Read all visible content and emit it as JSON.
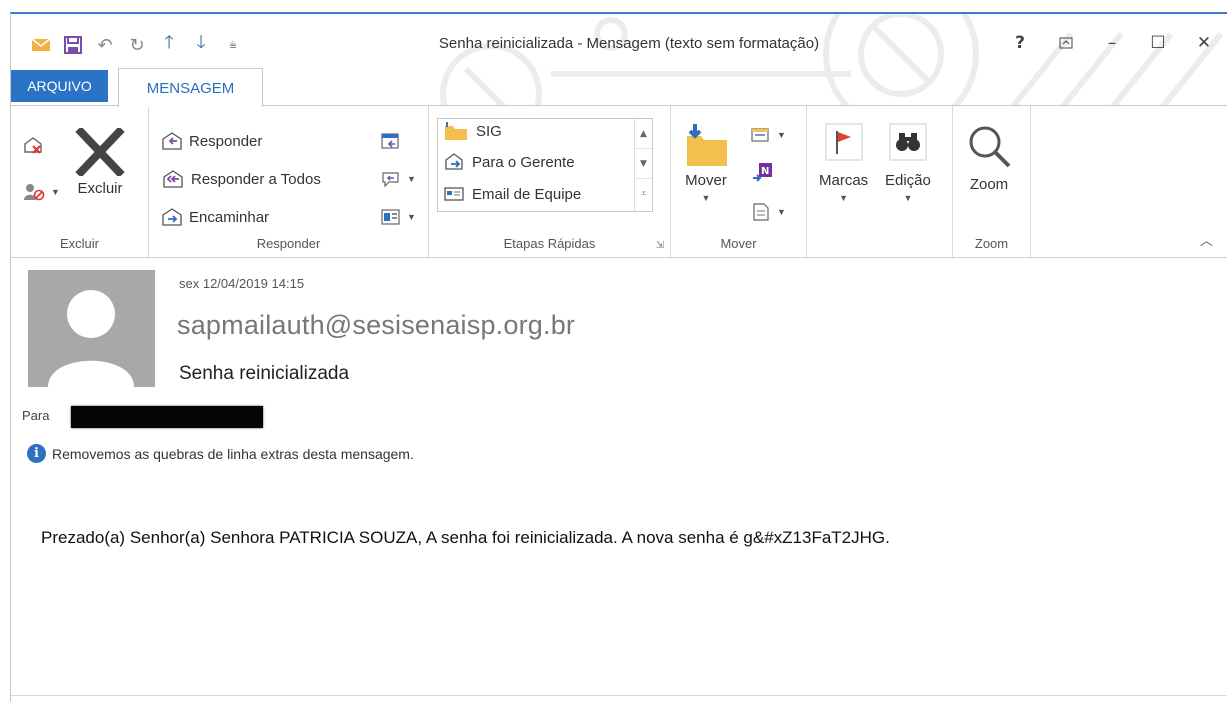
{
  "window": {
    "title": "Senha reinicializada - Mensagem (texto sem formatação)",
    "controls": {
      "help": "?",
      "ribbon_display": "⊼",
      "minimize": "–",
      "maximize": "☐",
      "close": "✕"
    }
  },
  "quick_access": [
    {
      "name": "mail-icon",
      "glyph": "✉"
    },
    {
      "name": "save-icon",
      "glyph": "🖫"
    },
    {
      "name": "undo-icon",
      "glyph": "↶"
    },
    {
      "name": "redo-icon",
      "glyph": "↻"
    },
    {
      "name": "up-arrow-icon",
      "glyph": "↑"
    },
    {
      "name": "down-arrow-icon",
      "glyph": "↓"
    },
    {
      "name": "customize-qat-icon",
      "glyph": "⩧"
    }
  ],
  "tabs": {
    "arquivo": "ARQUIVO",
    "mensagem": "MENSAGEM"
  },
  "ribbon": {
    "excluir": {
      "group_label": "Excluir",
      "delete_label": "Excluir"
    },
    "responder": {
      "group_label": "Responder",
      "reply": "Responder",
      "reply_all": "Responder a Todos",
      "forward": "Encaminhar"
    },
    "etapas": {
      "group_label": "Etapas Rápidas",
      "items": [
        "SIG",
        "Para o Gerente",
        "Email de Equipe"
      ]
    },
    "mover": {
      "group_label": "Mover",
      "move_label": "Mover"
    },
    "marcas": {
      "label": "Marcas"
    },
    "edicao": {
      "label": "Edição"
    },
    "zoom": {
      "group_label": "Zoom",
      "label": "Zoom"
    }
  },
  "message": {
    "date": "sex 12/04/2019 14:15",
    "sender": "sapmailauth@sesisenaisp.org.br",
    "subject": "Senha reinicializada",
    "to_label": "Para",
    "info_notice": "Removemos as quebras de linha extras desta mensagem.",
    "body": "Prezado(a) Senhor(a) Senhora PATRICIA SOUZA, A senha foi reinicializada. A nova senha é g&#xZ13FaT2JHG."
  },
  "colors": {
    "accent": "#2b73c7",
    "flag": "#e0422b"
  }
}
